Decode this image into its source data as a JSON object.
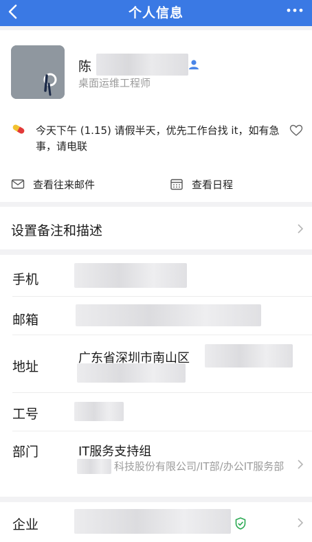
{
  "nav": {
    "title": "个人信息"
  },
  "profile": {
    "name": "陈",
    "job_title": "桌面运维工程师",
    "status": "今天下午 (1.15) 请假半天，优先工作台找 it，如有急事，请电联",
    "actions": [
      {
        "label": "查看往来邮件",
        "icon": "mail-icon"
      },
      {
        "label": "查看日程",
        "icon": "calendar-icon"
      }
    ]
  },
  "remark": {
    "label": "设置备注和描述"
  },
  "details": {
    "phone_label": "手机",
    "email_label": "邮箱",
    "address_label": "地址",
    "address_value": "广东省深圳市南山区",
    "employee_id_label": "工号",
    "department_label": "部门",
    "department_value": "IT服务支持组",
    "department_path": "科技股份有限公司/IT部/办公IT服务部"
  },
  "company": {
    "label": "企业"
  },
  "colors": {
    "nav": "#3a79e4",
    "accent": "#3a79e4",
    "verified": "#2aa952"
  }
}
